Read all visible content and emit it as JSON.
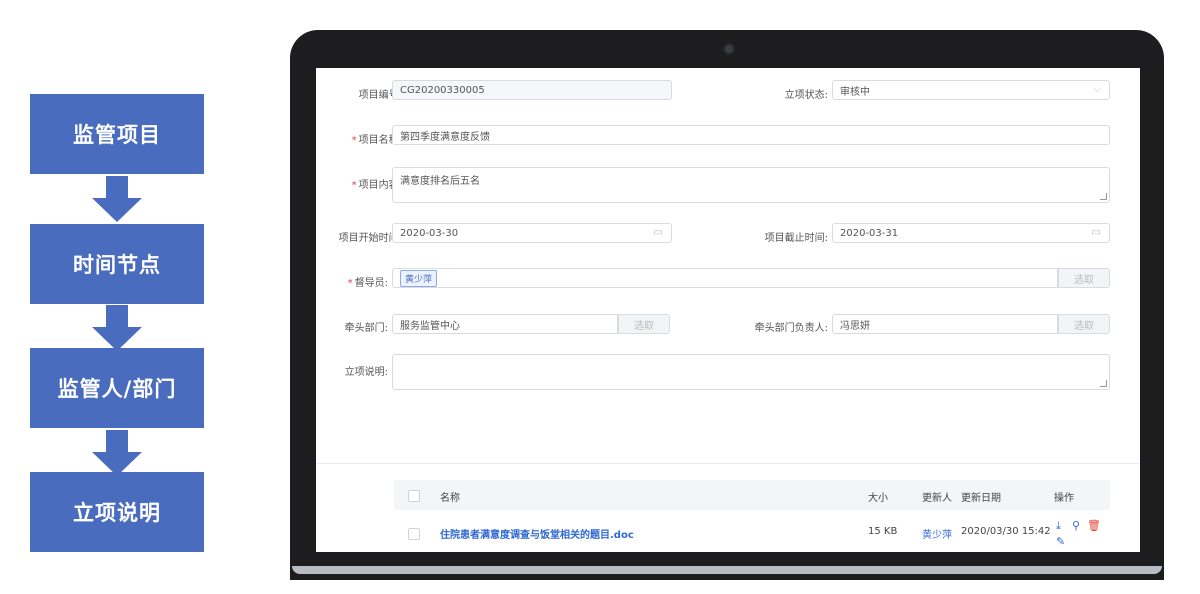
{
  "flow": {
    "steps": [
      "监管项目",
      "时间节点",
      "监管人/部门",
      "立项说明"
    ],
    "box_color": "#4a6cbf"
  },
  "form": {
    "project_no": {
      "label": "项目编号:",
      "value": "CG20200330005"
    },
    "status": {
      "label": "立项状态:",
      "value": "审核中",
      "icon": "chevron-down-icon"
    },
    "project_name": {
      "label": "项目名称:",
      "value": "第四季度满意度反馈",
      "required": "*"
    },
    "project_content": {
      "label": "项目内容:",
      "value": "满意度排名后五名",
      "required": "*"
    },
    "start_time": {
      "label": "项目开始时间:",
      "value": "2020-03-30",
      "icon": "calendar-icon"
    },
    "end_time": {
      "label": "项目截止时间:",
      "value": "2020-03-31",
      "icon": "calendar-icon"
    },
    "supervisor": {
      "label": "督导员:",
      "tag": "黄少萍",
      "required": "*",
      "pick_label": "选取"
    },
    "lead_dept": {
      "label": "牵头部门:",
      "value": "服务监管中心",
      "pick_label": "选取"
    },
    "lead_person": {
      "label": "牵头部门负责人:",
      "value": "冯思妍",
      "pick_label": "选取"
    },
    "description": {
      "label": "立项说明:",
      "value": ""
    }
  },
  "table": {
    "headers": {
      "name": "名称",
      "size": "大小",
      "updater": "更新人",
      "date": "更新日期",
      "actions": "操作"
    },
    "rows": [
      {
        "name": "住院患者满意度调查与饭堂相关的题目.doc",
        "size": "15 KB",
        "updater": "黄少萍",
        "date": "2020/03/30 15:42"
      }
    ],
    "action_icons": [
      "download-icon",
      "preview-icon",
      "delete-icon",
      "edit-icon"
    ]
  },
  "colors": {
    "accent": "#4a6cbf",
    "link": "#2f68d4",
    "danger": "#e0443a",
    "required": "#e0443a"
  }
}
